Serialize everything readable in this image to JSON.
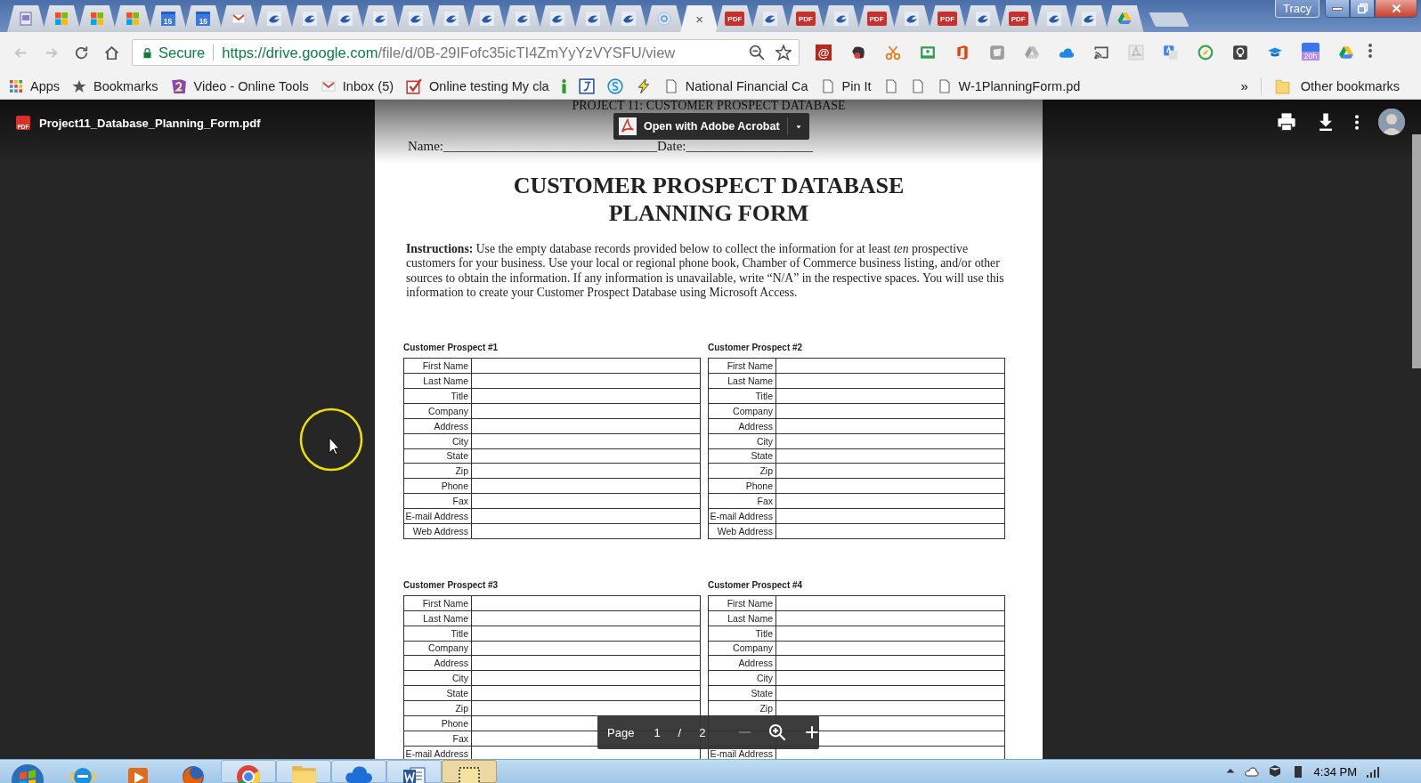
{
  "browser": {
    "tabs": [
      {
        "kind": "document",
        "selected": false
      },
      {
        "kind": "squares",
        "selected": false
      },
      {
        "kind": "squares",
        "selected": false
      },
      {
        "kind": "squares",
        "selected": false
      },
      {
        "kind": "calendar",
        "text": "15",
        "selected": false
      },
      {
        "kind": "calendar",
        "text": "15",
        "selected": false
      },
      {
        "kind": "envelope",
        "selected": false
      },
      {
        "kind": "bird",
        "selected": false
      },
      {
        "kind": "bird",
        "selected": false
      },
      {
        "kind": "bird",
        "selected": false
      },
      {
        "kind": "bird",
        "selected": false
      },
      {
        "kind": "bird",
        "selected": false
      },
      {
        "kind": "bird",
        "selected": false
      },
      {
        "kind": "bird",
        "selected": false
      },
      {
        "kind": "bird",
        "selected": false
      },
      {
        "kind": "bird",
        "selected": false
      },
      {
        "kind": "bird",
        "selected": false
      },
      {
        "kind": "bird",
        "selected": false
      },
      {
        "kind": "ring",
        "selected": false
      },
      {
        "kind": "blank",
        "selected": true,
        "close": "×"
      },
      {
        "kind": "pdf",
        "text": "PDF",
        "selected": false
      },
      {
        "kind": "bird",
        "selected": false
      },
      {
        "kind": "pdf",
        "text": "PDF",
        "selected": false
      },
      {
        "kind": "bird",
        "selected": false
      },
      {
        "kind": "pdf",
        "text": "PDF",
        "selected": false
      },
      {
        "kind": "bird",
        "selected": false
      },
      {
        "kind": "pdf",
        "text": "PDF",
        "selected": false
      },
      {
        "kind": "bird",
        "selected": false
      },
      {
        "kind": "pdf",
        "text": "PDF",
        "selected": false
      },
      {
        "kind": "bird",
        "selected": false
      },
      {
        "kind": "bird",
        "selected": false
      },
      {
        "kind": "triangle",
        "selected": false
      }
    ],
    "profile": "Tracy",
    "nav": [
      {
        "kind": "back",
        "disabled": true
      },
      {
        "kind": "forward",
        "disabled": true
      },
      {
        "kind": "reload",
        "disabled": false
      },
      {
        "kind": "home",
        "disabled": false
      }
    ],
    "address": {
      "security": "Secure",
      "origin": "https://drive.google.com",
      "path": "/file/d/0B-29IFofc35icTI4ZmYyYzVYSFU/view"
    },
    "extensions": [
      {
        "kind": "at",
        "text": "@"
      },
      {
        "kind": "elephant"
      },
      {
        "kind": "scissors"
      },
      {
        "kind": "board"
      },
      {
        "kind": "office"
      },
      {
        "kind": "shield"
      },
      {
        "kind": "drive-gray"
      },
      {
        "kind": "cloud"
      },
      {
        "kind": "cast"
      },
      {
        "kind": "acrobat"
      },
      {
        "kind": "translate"
      },
      {
        "kind": "compass"
      },
      {
        "kind": "bulb"
      },
      {
        "kind": "cap"
      },
      {
        "kind": "calendar",
        "badge": "20h"
      },
      {
        "kind": "drive"
      }
    ],
    "bookmarks": [
      {
        "kind": "apps",
        "label": "Apps"
      },
      {
        "kind": "star",
        "label": "Bookmarks"
      },
      {
        "kind": "video",
        "label": "Video - Online Tools"
      },
      {
        "kind": "envelope",
        "label": "Inbox (5)"
      },
      {
        "kind": "check",
        "label": "Online testing My cla"
      },
      {
        "kind": "info"
      },
      {
        "kind": "j"
      },
      {
        "kind": "s"
      },
      {
        "kind": "bolt"
      },
      {
        "kind": "page",
        "label": "National Financial Ca"
      },
      {
        "kind": "page",
        "label": "Pin It"
      },
      {
        "kind": "page"
      },
      {
        "kind": "page"
      },
      {
        "kind": "page",
        "label": "W-1PlanningForm.pd"
      }
    ],
    "overflow": "»",
    "other_bookmarks": "Other bookmarks"
  },
  "viewer": {
    "file_name": "Project11_Database_Planning_Form.pdf",
    "file_badge": "PDF",
    "open_with": "Open with Adobe Acrobat",
    "document": {
      "header": "PROJECT 11: CUSTOMER PROSPECT DATABASE",
      "name_line": "Name:________________________________Date:___________________",
      "title": [
        "CUSTOMER PROSPECT DATABASE",
        "PLANNING FORM"
      ],
      "instructions": "**Instructions:** Use the empty database records provided below to collect the information for at least *ten* prospective customers for your business. Use your local or regional phone book, Chamber of Commerce business listing, and/or other sources to obtain the information. If any information is unavailable, write “N/A” in the respective spaces. You will use this information to create your Customer Prospect Database using Microsoft Access.",
      "prospects": [
        {
          "heading": "Customer Prospect #1",
          "fields": [
            {
              "label": "First Name"
            },
            {
              "label": "Last Name"
            },
            {
              "label": "Title"
            },
            {
              "label": "Company"
            },
            {
              "label": "Address"
            },
            {
              "label": "City"
            },
            {
              "label": "State"
            },
            {
              "label": "Zip"
            },
            {
              "label": "Phone"
            },
            {
              "label": "Fax"
            },
            {
              "label": "E-mail Address"
            },
            {
              "label": "Web Address"
            }
          ]
        },
        {
          "heading": "Customer Prospect #2",
          "fields": [
            {
              "label": "First Name"
            },
            {
              "label": "Last Name"
            },
            {
              "label": "Title"
            },
            {
              "label": "Company"
            },
            {
              "label": "Address"
            },
            {
              "label": "City"
            },
            {
              "label": "State"
            },
            {
              "label": "Zip"
            },
            {
              "label": "Phone"
            },
            {
              "label": "Fax"
            },
            {
              "label": "E-mail Address"
            },
            {
              "label": "Web Address"
            }
          ]
        },
        {
          "heading": "Customer Prospect #3",
          "fields": [
            {
              "label": "First Name"
            },
            {
              "label": "Last Name"
            },
            {
              "label": "Title"
            },
            {
              "label": "Company"
            },
            {
              "label": "Address"
            },
            {
              "label": "City"
            },
            {
              "label": "State"
            },
            {
              "label": "Zip"
            },
            {
              "label": "Phone"
            },
            {
              "label": "Fax"
            },
            {
              "label": "E-mail Address"
            }
          ]
        },
        {
          "heading": "Customer Prospect #4",
          "fields": [
            {
              "label": "First Name"
            },
            {
              "label": "Last Name"
            },
            {
              "label": "Title"
            },
            {
              "label": "Company"
            },
            {
              "label": "Address"
            },
            {
              "label": "City"
            },
            {
              "label": "State"
            },
            {
              "label": "Zip"
            },
            {
              "kind": "covered"
            },
            {
              "kind": "covered"
            },
            {
              "label": "E-mail Address"
            }
          ]
        }
      ]
    },
    "page_controls": {
      "label": "Page",
      "current": "1",
      "separator": "/",
      "total": "2",
      "zoom_out_disabled": true
    }
  },
  "taskbar": {
    "apps": [
      {
        "kind": "start",
        "running": false,
        "active": false
      },
      {
        "kind": "globe",
        "running": false,
        "active": false
      },
      {
        "kind": "play",
        "running": false,
        "active": false
      },
      {
        "kind": "fox",
        "running": false,
        "active": false
      },
      {
        "kind": "wheel",
        "running": true,
        "active": false
      },
      {
        "kind": "folder",
        "running": true,
        "active": false
      },
      {
        "kind": "cloud",
        "running": true,
        "active": false
      },
      {
        "kind": "word",
        "running": true,
        "active": false
      },
      {
        "kind": "snip",
        "running": true,
        "active": true
      }
    ],
    "clock": "4:34 PM"
  }
}
